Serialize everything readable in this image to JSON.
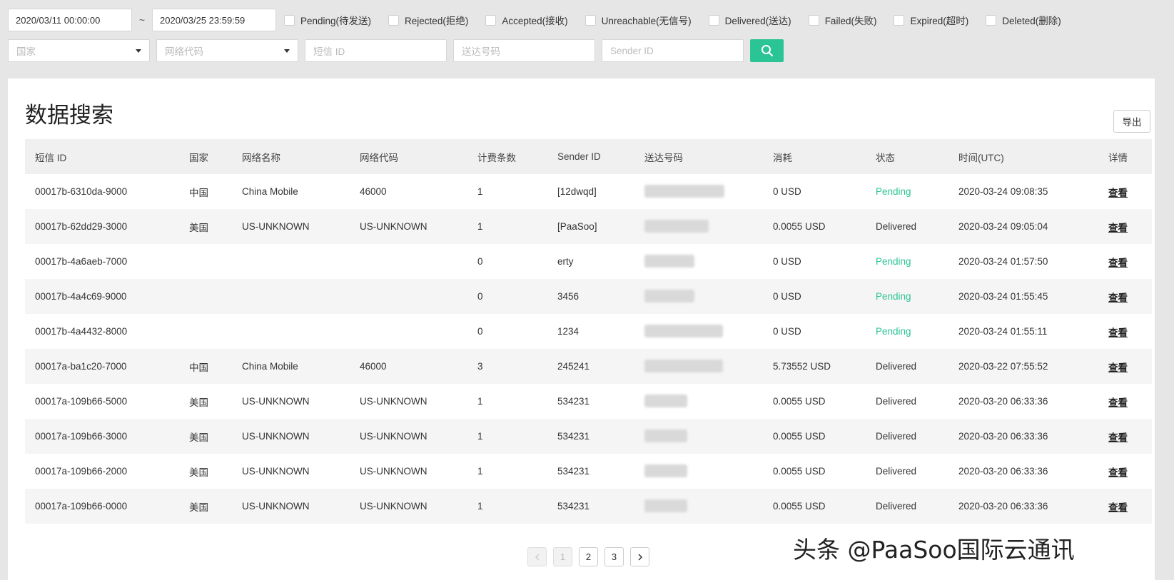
{
  "filters": {
    "date_from": "2020/03/11 00:00:00",
    "date_sep": "~",
    "date_to": "2020/03/25 23:59:59",
    "status_checkboxes": [
      {
        "label": "Pending(待发送)",
        "checked": false
      },
      {
        "label": "Rejected(拒绝)",
        "checked": false
      },
      {
        "label": "Accepted(接收)",
        "checked": false
      },
      {
        "label": "Unreachable(无信号)",
        "checked": false
      },
      {
        "label": "Delivered(送达)",
        "checked": false
      },
      {
        "label": "Failed(失败)",
        "checked": false
      },
      {
        "label": "Expired(超时)",
        "checked": false
      },
      {
        "label": "Deleted(删除)",
        "checked": false
      }
    ],
    "country_placeholder": "国家",
    "network_code_placeholder": "网络代码",
    "sms_id_placeholder": "短信 ID",
    "recipient_placeholder": "送达号码",
    "sender_id_placeholder": "Sender ID",
    "search_icon": "search-icon"
  },
  "panel": {
    "title": "数据搜索",
    "export_label": "导出"
  },
  "table": {
    "headers": [
      "短信 ID",
      "国家",
      "网络名称",
      "网络代码",
      "计费条数",
      "Sender ID",
      "送达号码",
      "消耗",
      "状态",
      "时间(UTC)",
      "详情"
    ],
    "rows": [
      {
        "id": "00017b-6310da-9000",
        "country": "中国",
        "network": "China Mobile",
        "code": "46000",
        "count": "1",
        "sender": "[12dwqd]",
        "cost": "0 USD",
        "status": "Pending",
        "time": "2020-03-24 09:08:35",
        "detail": "查看"
      },
      {
        "id": "00017b-62dd29-3000",
        "country": "美国",
        "network": "US-UNKNOWN",
        "code": "US-UNKNOWN",
        "count": "1",
        "sender": "[PaaSoo]",
        "cost": "0.0055 USD",
        "status": "Delivered",
        "time": "2020-03-24 09:05:04",
        "detail": "查看"
      },
      {
        "id": "00017b-4a6aeb-7000",
        "country": "",
        "network": "",
        "code": "",
        "count": "0",
        "sender": "erty",
        "cost": "0 USD",
        "status": "Pending",
        "time": "2020-03-24 01:57:50",
        "detail": "查看"
      },
      {
        "id": "00017b-4a4c69-9000",
        "country": "",
        "network": "",
        "code": "",
        "count": "0",
        "sender": "3456",
        "cost": "0 USD",
        "status": "Pending",
        "time": "2020-03-24 01:55:45",
        "detail": "查看"
      },
      {
        "id": "00017b-4a4432-8000",
        "country": "",
        "network": "",
        "code": "",
        "count": "0",
        "sender": "1234",
        "cost": "0 USD",
        "status": "Pending",
        "time": "2020-03-24 01:55:11",
        "detail": "查看"
      },
      {
        "id": "00017a-ba1c20-7000",
        "country": "中国",
        "network": "China Mobile",
        "code": "46000",
        "count": "3",
        "sender": "245241",
        "cost": "5.73552 USD",
        "status": "Delivered",
        "time": "2020-03-22 07:55:52",
        "detail": "查看"
      },
      {
        "id": "00017a-109b66-5000",
        "country": "美国",
        "network": "US-UNKNOWN",
        "code": "US-UNKNOWN",
        "count": "1",
        "sender": "534231",
        "cost": "0.0055 USD",
        "status": "Delivered",
        "time": "2020-03-20 06:33:36",
        "detail": "查看"
      },
      {
        "id": "00017a-109b66-3000",
        "country": "美国",
        "network": "US-UNKNOWN",
        "code": "US-UNKNOWN",
        "count": "1",
        "sender": "534231",
        "cost": "0.0055 USD",
        "status": "Delivered",
        "time": "2020-03-20 06:33:36",
        "detail": "查看"
      },
      {
        "id": "00017a-109b66-2000",
        "country": "美国",
        "network": "US-UNKNOWN",
        "code": "US-UNKNOWN",
        "count": "1",
        "sender": "534231",
        "cost": "0.0055 USD",
        "status": "Delivered",
        "time": "2020-03-20 06:33:36",
        "detail": "查看"
      },
      {
        "id": "00017a-109b66-0000",
        "country": "美国",
        "network": "US-UNKNOWN",
        "code": "US-UNKNOWN",
        "count": "1",
        "sender": "534231",
        "cost": "0.0055 USD",
        "status": "Delivered",
        "time": "2020-03-20 06:33:36",
        "detail": "查看"
      }
    ]
  },
  "pagination": {
    "pages": [
      "1",
      "2",
      "3"
    ],
    "current": "1"
  },
  "watermark": "头条 @PaaSoo国际云通讯",
  "colors": {
    "accent": "#2bc495",
    "pending": "#2bc495"
  }
}
